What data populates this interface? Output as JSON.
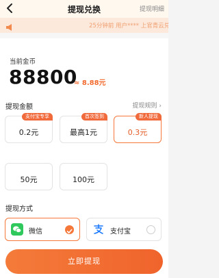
{
  "header": {
    "title": "提现兑换",
    "detail_link": "提现明细"
  },
  "notice": {
    "text": "25分钟前 用户**** 上官青云兑"
  },
  "coins": {
    "label": "当前金币",
    "amount": "88800",
    "cash": "≈ 8.88元"
  },
  "amount_section": {
    "label": "提现金额",
    "rules_link": "提现规则 ›",
    "options": [
      {
        "value": "0.2元",
        "tag": "支付宝专享",
        "selected": false
      },
      {
        "value": "最高1元",
        "tag": "首次签到",
        "selected": false
      },
      {
        "value": "0.3元",
        "tag": "新人提现",
        "selected": true
      },
      {
        "value": "50元",
        "tag": "",
        "selected": false
      },
      {
        "value": "100元",
        "tag": "",
        "selected": false
      }
    ]
  },
  "pay_section": {
    "label": "提现方式",
    "methods": [
      {
        "name": "微信",
        "icon": "wechat-icon",
        "selected": true
      },
      {
        "name": "支付宝",
        "icon": "alipay-icon",
        "selected": false
      }
    ]
  },
  "submit": {
    "label": "立即提现"
  },
  "colors": {
    "accent": "#f5773a",
    "wechat": "#2fc85c",
    "alipay": "#1677ff"
  }
}
